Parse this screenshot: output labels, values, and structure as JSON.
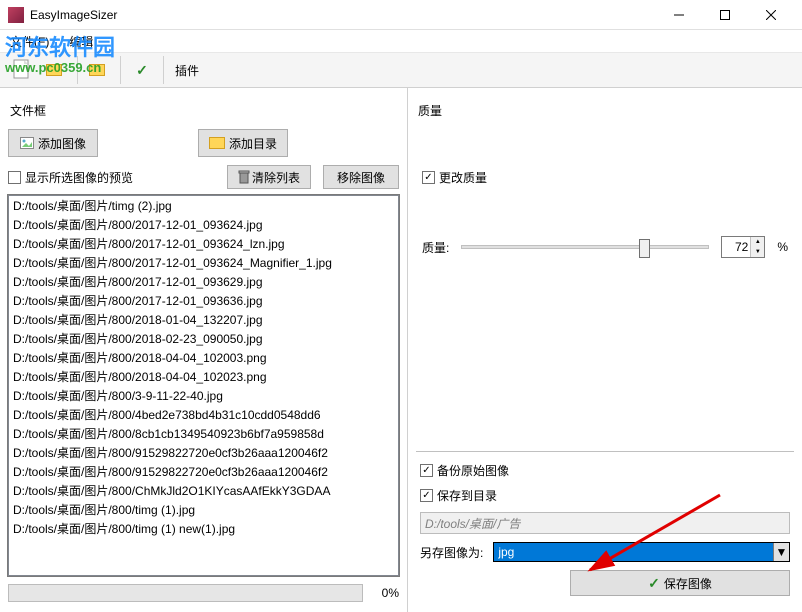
{
  "window": {
    "title": "EasyImageSizer"
  },
  "menu": {
    "file": "文件(F)",
    "edit": "编辑"
  },
  "toolbar": {
    "plugins": "插件"
  },
  "left": {
    "group_label": "文件框",
    "add_images": "添加图像",
    "add_folder": "添加目录",
    "show_preview": "显示所选图像的预览",
    "clear_list": "清除列表",
    "remove_images": "移除图像",
    "progress_pct": "0%",
    "files": [
      "D:/tools/桌面/图片/timg (2).jpg",
      "D:/tools/桌面/图片/800/2017-12-01_093624.jpg",
      "D:/tools/桌面/图片/800/2017-12-01_093624_lzn.jpg",
      "D:/tools/桌面/图片/800/2017-12-01_093624_Magnifier_1.jpg",
      "D:/tools/桌面/图片/800/2017-12-01_093629.jpg",
      "D:/tools/桌面/图片/800/2017-12-01_093636.jpg",
      "D:/tools/桌面/图片/800/2018-01-04_132207.jpg",
      "D:/tools/桌面/图片/800/2018-02-23_090050.jpg",
      "D:/tools/桌面/图片/800/2018-04-04_102003.png",
      "D:/tools/桌面/图片/800/2018-04-04_102023.png",
      "D:/tools/桌面/图片/800/3-9-11-22-40.jpg",
      "D:/tools/桌面/图片/800/4bed2e738bd4b31c10cdd0548dd6",
      "D:/tools/桌面/图片/800/8cb1cb1349540923b6bf7a959858d",
      "D:/tools/桌面/图片/800/91529822720e0cf3b26aaa120046f2",
      "D:/tools/桌面/图片/800/91529822720e0cf3b26aaa120046f2",
      "D:/tools/桌面/图片/800/ChMkJld2O1KIYcasAAfEkkY3GDAA",
      "D:/tools/桌面/图片/800/timg (1).jpg",
      "D:/tools/桌面/图片/800/timg (1) new(1).jpg"
    ]
  },
  "right": {
    "group_label": "质量",
    "change_quality": "更改质量",
    "quality_label": "质量:",
    "quality_value": "72",
    "quality_unit": "%",
    "backup_original": "备份原始图像",
    "save_to_dir": "保存到目录",
    "save_path": "D:/tools/桌面/广告",
    "save_as_label": "另存图像为:",
    "format": "jpg",
    "save_button": "保存图像"
  },
  "watermark": {
    "top": "河东软件园",
    "sub": "www.pc0359.cn"
  }
}
